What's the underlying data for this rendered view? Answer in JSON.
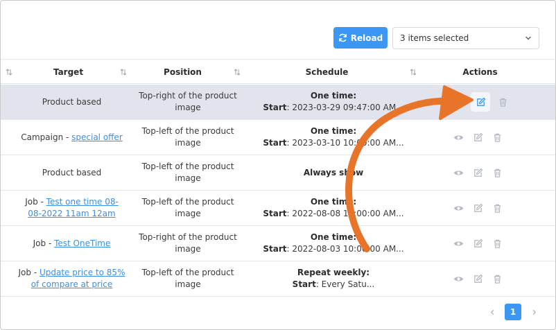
{
  "toolbar": {
    "reload_label": "Reload",
    "filter_value": "3 items selected"
  },
  "columns": [
    "Target",
    "Position",
    "Schedule",
    "Actions"
  ],
  "rows": [
    {
      "target": "Product based",
      "target_prefix": "",
      "target_link": "",
      "position": "Top-right of the product image",
      "schedule_type": "One time:",
      "schedule_key": "Start",
      "schedule_value": ": 2023-03-29 09:47:00 AM..."
    },
    {
      "target": "",
      "target_prefix": "Campaign - ",
      "target_link": "special offer",
      "position": "Top-left of the product image",
      "schedule_type": "One time:",
      "schedule_key": "Start",
      "schedule_value": ": 2023-03-10 10:00:00 AM..."
    },
    {
      "target": "Product based",
      "target_prefix": "",
      "target_link": "",
      "position": "Top-left of the product image",
      "schedule_type": "Always show",
      "schedule_key": "",
      "schedule_value": ""
    },
    {
      "target": "",
      "target_prefix": "Job - ",
      "target_link": "Test one time 08-08-2022 11am 12am",
      "position": "Top-left of the product image",
      "schedule_type": "One time:",
      "schedule_key": "Start",
      "schedule_value": ": 2022-08-08 10:00:00 AM..."
    },
    {
      "target": "",
      "target_prefix": "Job - ",
      "target_link": "Test OneTime",
      "position": "Top-right of the product image",
      "schedule_type": "One time:",
      "schedule_key": "Start",
      "schedule_value": ": 2022-08-03 10:00:00 AM..."
    },
    {
      "target": "",
      "target_prefix": "Job - ",
      "target_link": "Update price to 85% of compare at price",
      "position": "Top-left of the product image",
      "schedule_type": "Repeat weekly:",
      "schedule_key": "Start",
      "schedule_value": ": Every Satu..."
    }
  ],
  "pagination": {
    "current_page": "1"
  },
  "colors": {
    "accent": "#3b96f4",
    "link": "#3a8ee6",
    "arrow": "#e8742a",
    "selected_row": "#e1e4ed"
  },
  "icons": [
    "sync-icon",
    "chevron-down-icon",
    "sort-icon",
    "eye-icon",
    "edit-icon",
    "trash-icon",
    "chevron-left-icon",
    "chevron-right-icon"
  ]
}
